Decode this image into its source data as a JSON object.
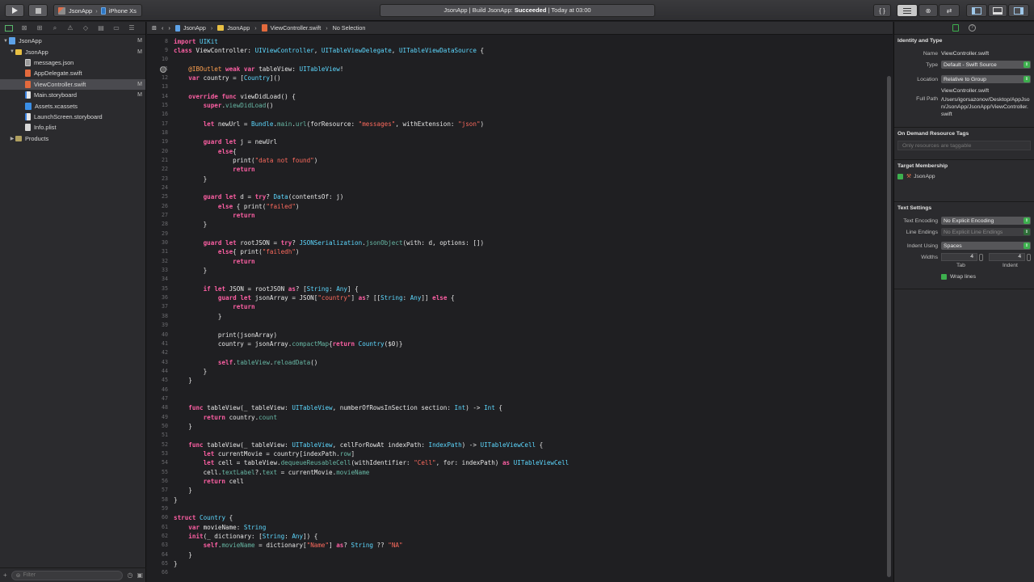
{
  "toolbar": {
    "scheme": "JsonApp",
    "device": "iPhone Xs",
    "activity_prefix": "JsonApp | Build JsonApp: ",
    "activity_status": "Succeeded",
    "activity_suffix": " | Today at 03:00"
  },
  "navigator": {
    "items": [
      {
        "label": "JsonApp",
        "flag": "M"
      },
      {
        "label": "JsonApp",
        "flag": "M"
      },
      {
        "label": "messages.json",
        "flag": ""
      },
      {
        "label": "AppDelegate.swift",
        "flag": ""
      },
      {
        "label": "ViewController.swift",
        "flag": "M"
      },
      {
        "label": "Main.storyboard",
        "flag": "M"
      },
      {
        "label": "Assets.xcassets",
        "flag": ""
      },
      {
        "label": "LaunchScreen.storyboard",
        "flag": ""
      },
      {
        "label": "Info.plist",
        "flag": ""
      },
      {
        "label": "Products",
        "flag": ""
      }
    ],
    "filter_placeholder": "Filter"
  },
  "jumpbar": {
    "project": "JsonApp",
    "group": "JsonApp",
    "file": "ViewController.swift",
    "symbol": "No Selection"
  },
  "editor": {
    "first_line": 8,
    "lines": [
      "import UIKit",
      "class ViewController: UIViewController, UITableViewDelegate, UITableViewDataSource {",
      "",
      "    @IBOutlet weak var tableView: UITableView!",
      "    var country = [Country]()",
      "",
      "    override func viewDidLoad() {",
      "        super.viewDidLoad()",
      "",
      "        let newUrl = Bundle.main.url(forResource: \"messages\", withExtension: \"json\")",
      "",
      "        guard let j = newUrl",
      "            else{",
      "                print(\"data not found\")",
      "                return",
      "        }",
      "",
      "        guard let d = try? Data(contentsOf: j)",
      "            else { print(\"failed\")",
      "                return",
      "        }",
      "",
      "        guard let rootJSON = try? JSONSerialization.jsonObject(with: d, options: [])",
      "            else{ print(\"failedh\")",
      "                return",
      "        }",
      "",
      "        if let JSON = rootJSON as? [String: Any] {",
      "            guard let jsonArray = JSON[\"country\"] as? [[String: Any]] else {",
      "                return",
      "            }",
      "",
      "            print(jsonArray)",
      "            country = jsonArray.compactMap{return Country($0)}",
      "",
      "            self.tableView.reloadData()",
      "        }",
      "    }",
      "",
      "",
      "    func tableView(_ tableView: UITableView, numberOfRowsInSection section: Int) -> Int {",
      "        return country.count",
      "    }",
      "",
      "    func tableView(_ tableView: UITableView, cellForRowAt indexPath: IndexPath) -> UITableViewCell {",
      "        let currentMovie = country[indexPath.row]",
      "        let cell = tableView.dequeueReusableCell(withIdentifier: \"Cell\", for: indexPath) as UITableViewCell",
      "        cell.textLabel?.text = currentMovie.movieName",
      "        return cell",
      "    }",
      "}",
      "",
      "struct Country {",
      "    var movieName: String",
      "    init(_ dictionary: [String: Any]) {",
      "        self.movieName = dictionary[\"Name\"] as? String ?? \"NA\"",
      "    }",
      "}",
      ""
    ]
  },
  "inspector": {
    "identity_title": "Identity and Type",
    "name_label": "Name",
    "name_value": "ViewController.swift",
    "type_label": "Type",
    "type_value": "Default - Swift Source",
    "location_label": "Location",
    "location_value": "Relative to Group",
    "location_file": "ViewController.swift",
    "fullpath_label": "Full Path",
    "fullpath_value": "/Users/igorsazonov/Desktop/AppJson/JsonApp/JsonApp/ViewController.swift",
    "odr_title": "On Demand Resource Tags",
    "odr_placeholder": "Only resources are taggable",
    "target_title": "Target Membership",
    "target_name": "JsonApp",
    "text_title": "Text Settings",
    "encoding_label": "Text Encoding",
    "encoding_value": "No Explicit Encoding",
    "endings_label": "Line Endings",
    "endings_value": "No Explicit Line Endings",
    "indent_label": "Indent Using",
    "indent_value": "Spaces",
    "widths_label": "Widths",
    "tab_value": "4",
    "indent_width_value": "4",
    "tab_caption": "Tab",
    "indent_caption": "Indent",
    "wrap_label": "Wrap lines"
  }
}
